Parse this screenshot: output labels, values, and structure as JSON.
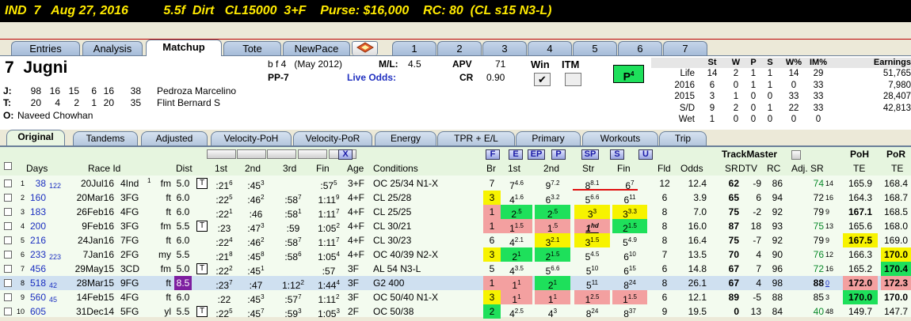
{
  "title": "IND  7   Aug 27, 2016          5.5f  Dirt   CL15000  3+F    Purse: $16,000    RC: 80  (CL s15 N3-L)",
  "tabs": [
    "Entries",
    "Analysis",
    "Matchup",
    "Tote",
    "NewPace",
    "1",
    "2",
    "3",
    "4",
    "5",
    "6",
    "7"
  ],
  "active_tab": "Matchup",
  "horse": {
    "number": "7",
    "name": "Jugni",
    "description": "b f 4   (May 2012)",
    "pp": "PP-7",
    "ml_label": "M/L:",
    "ml": "4.5",
    "live_odds_label": "Live Odds:",
    "apv_label": "APV",
    "apv": "71",
    "cr_label": "CR",
    "cr": "0.90",
    "win_label": "Win",
    "itm_label": "ITM",
    "win_checked": "✔",
    "p4": "P",
    "p4_sup": "4",
    "jockey_label": "J:",
    "jockey_stats": [
      "98",
      "16",
      "15",
      "6",
      "16",
      "38"
    ],
    "jockey": "Pedroza Marcelino",
    "trainer_label": "T:",
    "trainer_stats": [
      "20",
      "4",
      "2",
      "1",
      "20",
      "35"
    ],
    "trainer": "Flint Bernard S",
    "owner_label": "O:",
    "owner": "Naveed Chowhan"
  },
  "record": {
    "headers": [
      "St",
      "W",
      "P",
      "S",
      "W%",
      "IM%",
      "Earnings"
    ],
    "rows": [
      {
        "label": "Life",
        "vals": [
          "14",
          "2",
          "1",
          "1",
          "14",
          "29",
          "51,765"
        ]
      },
      {
        "label": "2016",
        "vals": [
          "6",
          "0",
          "1",
          "1",
          "0",
          "33",
          "7,980"
        ]
      },
      {
        "label": "2015",
        "vals": [
          "3",
          "1",
          "0",
          "0",
          "33",
          "33",
          "28,407"
        ]
      },
      {
        "label": "S/D",
        "vals": [
          "9",
          "2",
          "0",
          "1",
          "22",
          "33",
          "42,813"
        ]
      },
      {
        "label": "Wet",
        "vals": [
          "1",
          "0",
          "0",
          "0",
          "0",
          "0",
          ""
        ]
      }
    ]
  },
  "subtabs": [
    "Original",
    "Tandems",
    "Adjusted",
    "Velocity-PoH",
    "Velocity-PoR",
    "Energy",
    "TPR + E/L",
    "Primary",
    "Workouts",
    "Trip"
  ],
  "active_subtab": "Original",
  "grid_buttons": [
    "F",
    "E",
    "EP",
    "P",
    "SP",
    "S",
    "U"
  ],
  "x_button": "X",
  "trackmaster_label": "TrackMaster",
  "columns": [
    "Days",
    "Race Id",
    "Dist",
    "1st",
    "2nd",
    "3rd",
    "Fin",
    "Age",
    "Conditions",
    "Br",
    "1st",
    "2nd",
    "Str",
    "Fin",
    "Fld",
    "Odds",
    "SR",
    "DTV",
    "RC",
    "Adj. SR",
    "PoH",
    "TE",
    "PoR",
    "TE"
  ],
  "rows": [
    {
      "n": "1",
      "days": "38",
      "days2": "122",
      "date": "20Jul16",
      "race": "4Ind",
      "sup": "1",
      "surf": "fm",
      "dist": "5.0",
      "t": "T",
      "f1": ":21",
      "f1s": "6",
      "f2": ":45",
      "f2s": "3",
      "f3": "",
      "f3s": "",
      "fin": ":57",
      "fins": "5",
      "age": "3+F",
      "cond": "OC 25/34 N1-X",
      "br": "7",
      "c1": "7",
      "c1s": "4.6",
      "c2": "9",
      "c2s": "7.2",
      "str": "8",
      "strs": "8.1",
      "fn": "6",
      "fns": "7",
      "fld": "12",
      "odds": "12.4",
      "sr": "62",
      "dtv": "-9",
      "rc": "86",
      "adj": "74",
      "adjs": "14",
      "poh": "165.9",
      "por": "168.4"
    },
    {
      "n": "2",
      "days": "160",
      "days2": "",
      "date": "20Mar16",
      "race": "3FG",
      "sup": "",
      "surf": "ft",
      "dist": "6.0",
      "t": "",
      "f1": ":22",
      "f1s": "5",
      "f2": ":46",
      "f2s": "2",
      "f3": ":58",
      "f3s": "7",
      "fin": "1:11",
      "fins": "9",
      "age": "4+F",
      "cond": "CL 25/28",
      "br": "3",
      "c1": "4",
      "c1s": "1.6",
      "c2": "6",
      "c2s": "3.2",
      "str": "5",
      "strs": "6.6",
      "fn": "6",
      "fns": "11",
      "fld": "6",
      "odds": "3.9",
      "sr": "65",
      "dtv": "6",
      "rc": "94",
      "adj": "72",
      "adjs": "16",
      "poh": "164.3",
      "por": "168.7"
    },
    {
      "n": "3",
      "days": "183",
      "days2": "",
      "date": "26Feb16",
      "race": "4FG",
      "sup": "",
      "surf": "ft",
      "dist": "6.0",
      "t": "",
      "f1": ":22",
      "f1s": "1",
      "f2": ":46",
      "f2s": "",
      "f3": ":58",
      "f3s": "1",
      "fin": "1:11",
      "fins": "7",
      "age": "4+F",
      "cond": "CL 25/25",
      "br": "1",
      "c1": "2",
      "c1s": ".5",
      "c2": "2",
      "c2s": ".5",
      "str": "3",
      "strs": "3",
      "fn": "3",
      "fns": "3.3",
      "fld": "8",
      "odds": "7.0",
      "sr": "75",
      "dtv": "-2",
      "rc": "92",
      "adj": "79",
      "adjs": "9",
      "poh": "167.1",
      "por": "168.5"
    },
    {
      "n": "4",
      "days": "200",
      "days2": "",
      "date": "9Feb16",
      "race": "3FG",
      "sup": "",
      "surf": "fm",
      "dist": "5.5",
      "t": "T",
      "f1": ":23",
      "f1s": "",
      "f2": ":47",
      "f2s": "3",
      "f3": ":59",
      "f3s": "",
      "fin": "1:05",
      "fins": "2",
      "age": "4+F",
      "cond": "CL 30/21",
      "br": "1",
      "c1": "1",
      "c1s": "1.5",
      "c2": "1",
      "c2s": ".5",
      "str": "1",
      "strs": "hd",
      "fn": "2",
      "fns": "1.5",
      "fld": "8",
      "odds": "16.0",
      "sr": "87",
      "dtv": "18",
      "rc": "93",
      "adj": "75",
      "adjs": "13",
      "poh": "165.6",
      "por": "168.0"
    },
    {
      "n": "5",
      "days": "216",
      "days2": "",
      "date": "24Jan16",
      "race": "7FG",
      "sup": "",
      "surf": "ft",
      "dist": "6.0",
      "t": "",
      "f1": ":22",
      "f1s": "4",
      "f2": ":46",
      "f2s": "2",
      "f3": ":58",
      "f3s": "7",
      "fin": "1:11",
      "fins": "7",
      "age": "4+F",
      "cond": "CL 30/23",
      "br": "6",
      "c1": "4",
      "c1s": "2.1",
      "c2": "3",
      "c2s": "2.1",
      "str": "3",
      "strs": "1.5",
      "fn": "5",
      "fns": "4.9",
      "fld": "8",
      "odds": "16.4",
      "sr": "75",
      "dtv": "-7",
      "rc": "92",
      "adj": "79",
      "adjs": "9",
      "poh": "167.5",
      "por": "169.0"
    },
    {
      "n": "6",
      "days": "233",
      "days2": "223",
      "date": "7Jan16",
      "race": "2FG",
      "sup": "",
      "surf": "my",
      "dist": "5.5",
      "t": "",
      "f1": ":21",
      "f1s": "8",
      "f2": ":45",
      "f2s": "8",
      "f3": ":58",
      "f3s": "6",
      "fin": "1:05",
      "fins": "4",
      "age": "4+F",
      "cond": "OC 40/39 N2-X",
      "br": "3",
      "c1": "2",
      "c1s": "1",
      "c2": "2",
      "c2s": "1.5",
      "str": "5",
      "strs": "4.5",
      "fn": "6",
      "fns": "10",
      "fld": "7",
      "odds": "13.5",
      "sr": "70",
      "dtv": "4",
      "rc": "90",
      "adj": "76",
      "adjs": "12",
      "poh": "166.3",
      "por": "170.0"
    },
    {
      "n": "7",
      "days": "456",
      "days2": "",
      "date": "29May15",
      "race": "3CD",
      "sup": "",
      "surf": "fm",
      "dist": "5.0",
      "t": "T",
      "f1": ":22",
      "f1s": "2",
      "f2": ":45",
      "f2s": "1",
      "f3": "",
      "f3s": "",
      "fin": ":57",
      "fins": "",
      "age": "3F",
      "cond": "AL 54 N3-L",
      "br": "5",
      "c1": "4",
      "c1s": "3.5",
      "c2": "5",
      "c2s": "6.6",
      "str": "5",
      "strs": "10",
      "fn": "6",
      "fns": "15",
      "fld": "6",
      "odds": "14.8",
      "sr": "67",
      "dtv": "7",
      "rc": "96",
      "adj": "72",
      "adjs": "16",
      "poh": "165.2",
      "por": "170.4"
    },
    {
      "n": "8",
      "days": "518",
      "days2": "42",
      "date": "28Mar15",
      "race": "9FG",
      "sup": "",
      "surf": "ft",
      "dist": "8.5",
      "t": "",
      "f1": ":23",
      "f1s": "7",
      "f2": ":47",
      "f2s": "",
      "f3": "1:12",
      "f3s": "2",
      "fin": "1:44",
      "fins": "4",
      "age": "3F",
      "cond": "G2 400",
      "br": "1",
      "c1": "1",
      "c1s": "1",
      "c2": "2",
      "c2s": "1",
      "str": "5",
      "strs": "11",
      "fn": "8",
      "fns": "24",
      "fld": "8",
      "odds": "26.1",
      "sr": "67",
      "dtv": "4",
      "rc": "98",
      "adj": "88",
      "adjs": "0",
      "poh": "172.0",
      "por": "172.3"
    },
    {
      "n": "9",
      "days": "560",
      "days2": "45",
      "date": "14Feb15",
      "race": "4FG",
      "sup": "",
      "surf": "ft",
      "dist": "6.0",
      "t": "",
      "f1": ":22",
      "f1s": "",
      "f2": ":45",
      "f2s": "3",
      "f3": ":57",
      "f3s": "7",
      "fin": "1:11",
      "fins": "2",
      "age": "3F",
      "cond": "OC 50/40 N1-X",
      "br": "3",
      "c1": "1",
      "c1s": "1",
      "c2": "1",
      "c2s": "1",
      "str": "1",
      "strs": "2.5",
      "fn": "1",
      "fns": "1.5",
      "fld": "6",
      "odds": "12.1",
      "sr": "89",
      "dtv": "-5",
      "rc": "88",
      "adj": "85",
      "adjs": "3",
      "poh": "170.0",
      "por": "170.0"
    },
    {
      "n": "10",
      "days": "605",
      "days2": "",
      "date": "31Dec14",
      "race": "5FG",
      "sup": "",
      "surf": "yl",
      "dist": "5.5",
      "t": "T",
      "f1": ":22",
      "f1s": "5",
      "f2": ":45",
      "f2s": "7",
      "f3": ":59",
      "f3s": "3",
      "fin": "1:05",
      "fins": "3",
      "age": "2F",
      "cond": "OC 50/38",
      "br": "2",
      "c1": "4",
      "c1s": "2.5",
      "c2": "4",
      "c2s": "3",
      "str": "8",
      "strs": "24",
      "fn": "8",
      "fns": "37",
      "fld": "9",
      "odds": "19.5",
      "sr": "0",
      "dtv": "13",
      "rc": "84",
      "adj": "40",
      "adjs": "48",
      "poh": "149.7",
      "por": "147.7"
    }
  ]
}
